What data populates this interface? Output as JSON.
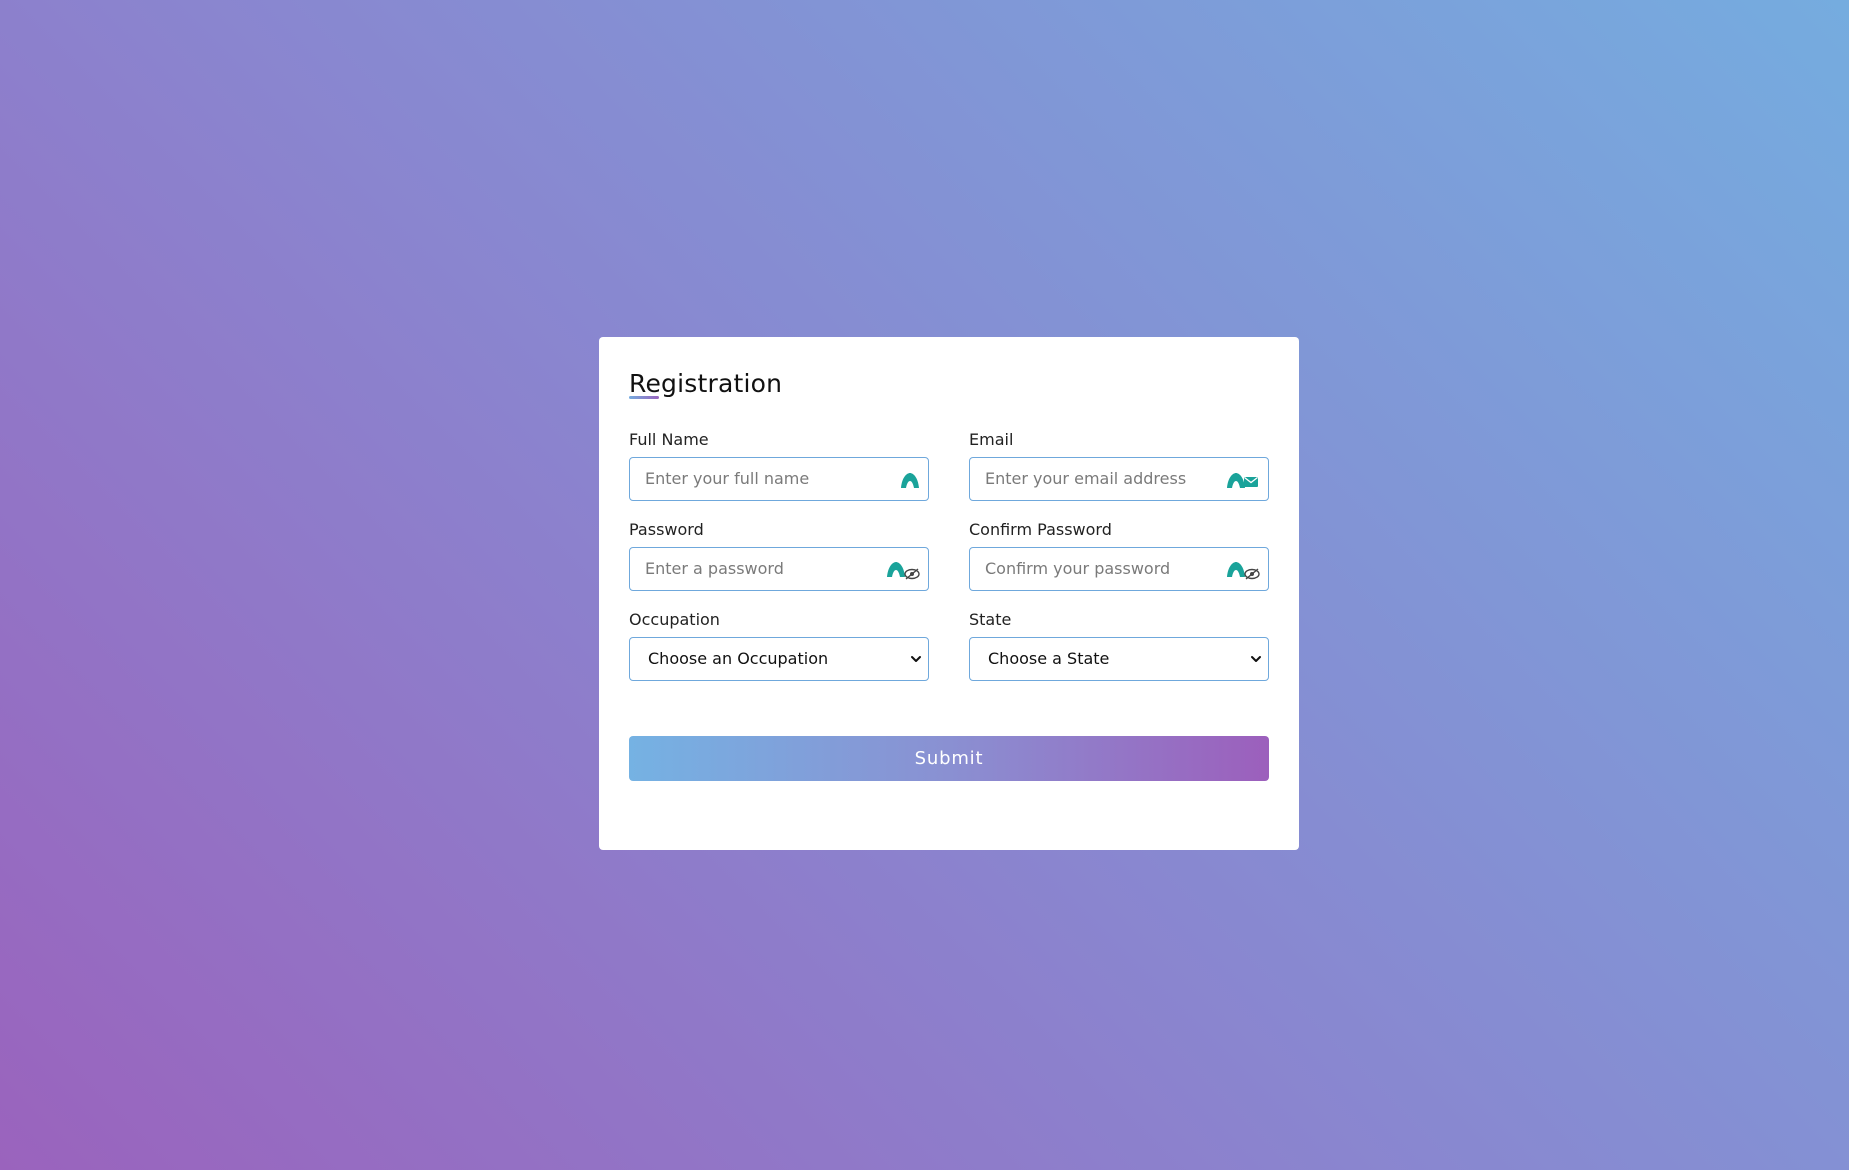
{
  "form": {
    "title": "Registration",
    "fields": {
      "full_name": {
        "label": "Full Name",
        "placeholder": "Enter your full name",
        "value": "",
        "icon": "user-icon"
      },
      "email": {
        "label": "Email",
        "placeholder": "Enter your email address",
        "value": "",
        "icon": "envelope-icon"
      },
      "password": {
        "label": "Password",
        "placeholder": "Enter a password",
        "value": "",
        "icon": "eye-slash-icon"
      },
      "confirm_password": {
        "label": "Confirm Password",
        "placeholder": "Confirm your password",
        "value": "",
        "icon": "eye-slash-icon"
      }
    },
    "selects": {
      "occupation": {
        "label": "Occupation",
        "selected": "Choose an Occupation"
      },
      "state": {
        "label": "State",
        "selected": "Choose a State"
      }
    },
    "submit_label": "Submit"
  },
  "colors": {
    "accent": "#6fa8dc",
    "icon_teal": "#1aa39a",
    "gradient_start": "#75b2e3",
    "gradient_end": "#9c5fbc"
  }
}
